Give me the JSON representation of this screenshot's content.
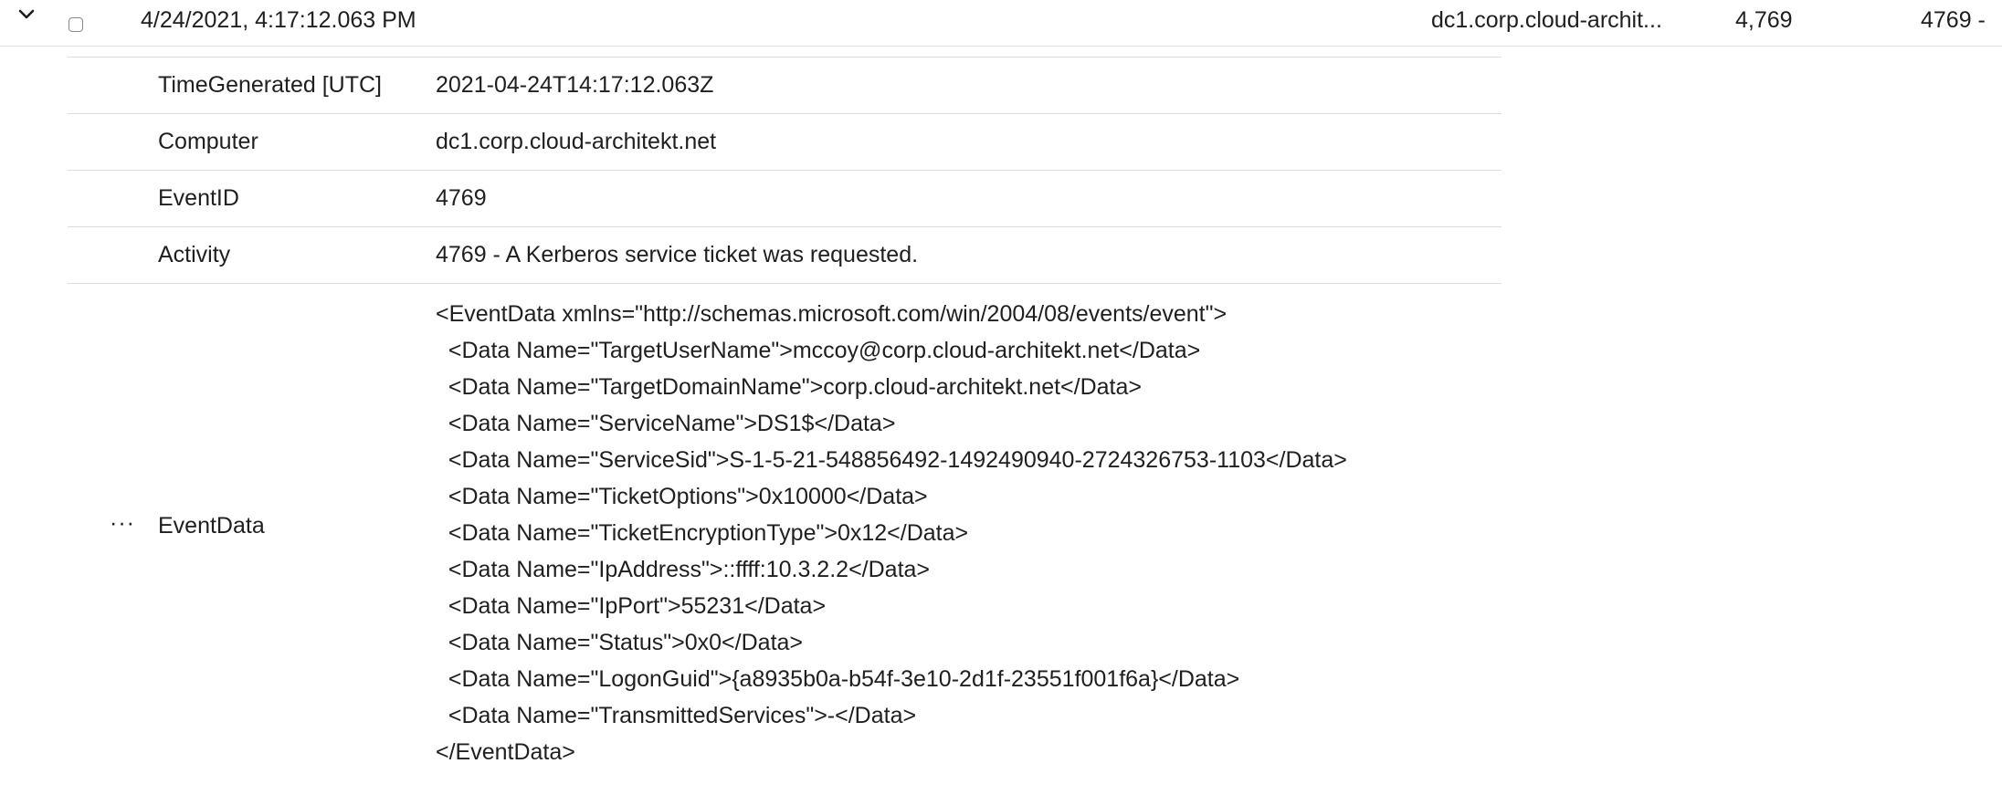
{
  "row": {
    "timestamp": "4/24/2021, 4:17:12.063 PM",
    "computer": "dc1.corp.cloud-archit...",
    "event_id": "4,769",
    "activity": "4769 -"
  },
  "details": {
    "time_generated": {
      "key": "TimeGenerated [UTC]",
      "value": "2021-04-24T14:17:12.063Z"
    },
    "computer": {
      "key": "Computer",
      "value": "dc1.corp.cloud-architekt.net"
    },
    "event_id": {
      "key": "EventID",
      "value": "4769"
    },
    "activity": {
      "key": "Activity",
      "value": "4769 - A Kerberos service ticket was requested."
    },
    "event_data": {
      "key": "EventData",
      "more": "···",
      "lines": [
        "<EventData xmlns=\"http://schemas.microsoft.com/win/2004/08/events/event\">",
        "  <Data Name=\"TargetUserName\">mccoy@corp.cloud-architekt.net</Data>",
        "  <Data Name=\"TargetDomainName\">corp.cloud-architekt.net</Data>",
        "  <Data Name=\"ServiceName\">DS1$</Data>",
        "  <Data Name=\"ServiceSid\">S-1-5-21-548856492-1492490940-2724326753-1103</Data>",
        "  <Data Name=\"TicketOptions\">0x10000</Data>",
        "  <Data Name=\"TicketEncryptionType\">0x12</Data>",
        "  <Data Name=\"IpAddress\">::ffff:10.3.2.2</Data>",
        "  <Data Name=\"IpPort\">55231</Data>",
        "  <Data Name=\"Status\">0x0</Data>",
        "  <Data Name=\"LogonGuid\">{a8935b0a-b54f-3e10-2d1f-23551f001f6a}</Data>",
        "  <Data Name=\"TransmittedServices\">-</Data>",
        "</EventData>"
      ]
    }
  },
  "icons": {
    "expand": "chevron-down-icon",
    "more": "more-options-icon"
  },
  "colors": {
    "text": "#1f1f1f",
    "divider": "#dcdcdc",
    "background": "#ffffff"
  }
}
